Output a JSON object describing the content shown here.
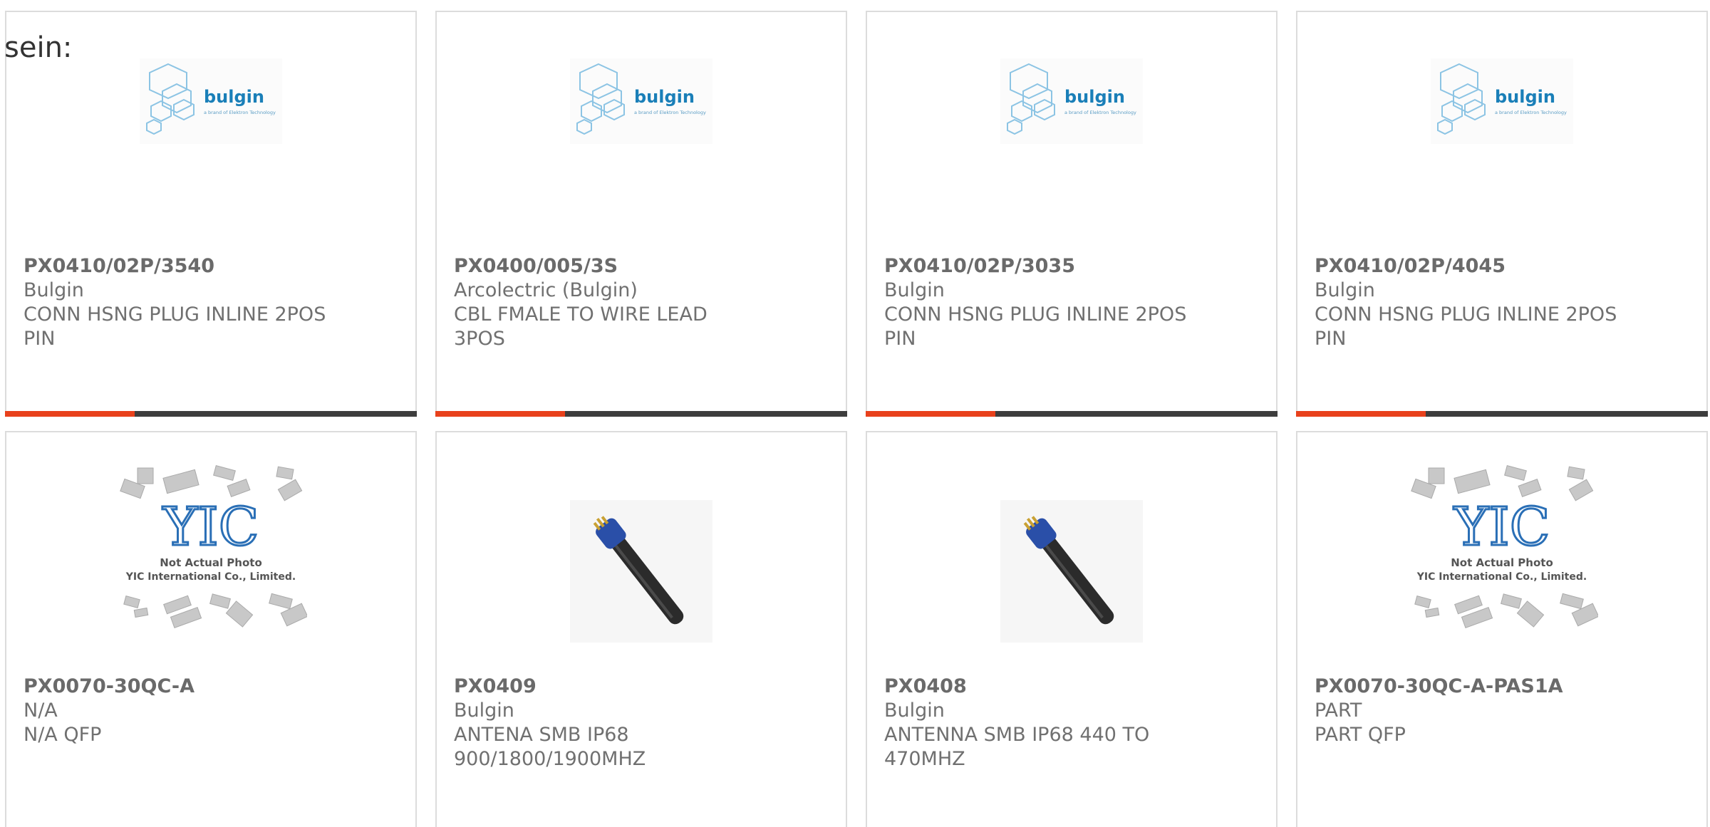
{
  "intro_text": "sein:",
  "colors": {
    "accent": "#e8411c",
    "bar": "#3d3d3d",
    "bulgin_blue": "#1a7fb8",
    "yic_blue": "#2a6fb6",
    "antenna_blue": "#2a4fa8"
  },
  "products": [
    {
      "part": "PX0410/02P/3540",
      "maker": "Bulgin",
      "desc": "CONN HSNG PLUG INLINE 2POS PIN",
      "image": "bulgin-logo"
    },
    {
      "part": "PX0400/005/3S",
      "maker": "Arcolectric (Bulgin)",
      "desc": "CBL FMALE TO WIRE LEAD 3POS",
      "image": "bulgin-logo"
    },
    {
      "part": "PX0410/02P/3035",
      "maker": "Bulgin",
      "desc": "CONN HSNG PLUG INLINE 2POS PIN",
      "image": "bulgin-logo"
    },
    {
      "part": "PX0410/02P/4045",
      "maker": "Bulgin",
      "desc": "CONN HSNG PLUG INLINE 2POS PIN",
      "image": "bulgin-logo"
    },
    {
      "part": "PX0070-30QC-A",
      "maker": "N/A",
      "desc": "N/A QFP",
      "image": "yic-placeholder"
    },
    {
      "part": "PX0409",
      "maker": "Bulgin",
      "desc": "ANTENA SMB IP68 900/1800/1900MHZ",
      "image": "antenna-photo"
    },
    {
      "part": "PX0408",
      "maker": "Bulgin",
      "desc": "ANTENNA SMB IP68 440 TO 470MHZ",
      "image": "antenna-photo"
    },
    {
      "part": "PX0070-30QC-A-PAS1A",
      "maker": "PART",
      "desc": "PART QFP",
      "image": "yic-placeholder"
    }
  ],
  "logos": {
    "bulgin_word": "bulgin",
    "bulgin_tagline": "a brand of Elektron Technology",
    "yic_mark": "YIC",
    "yic_line1": "Not Actual Photo",
    "yic_line2": "YIC International Co., Limited."
  }
}
